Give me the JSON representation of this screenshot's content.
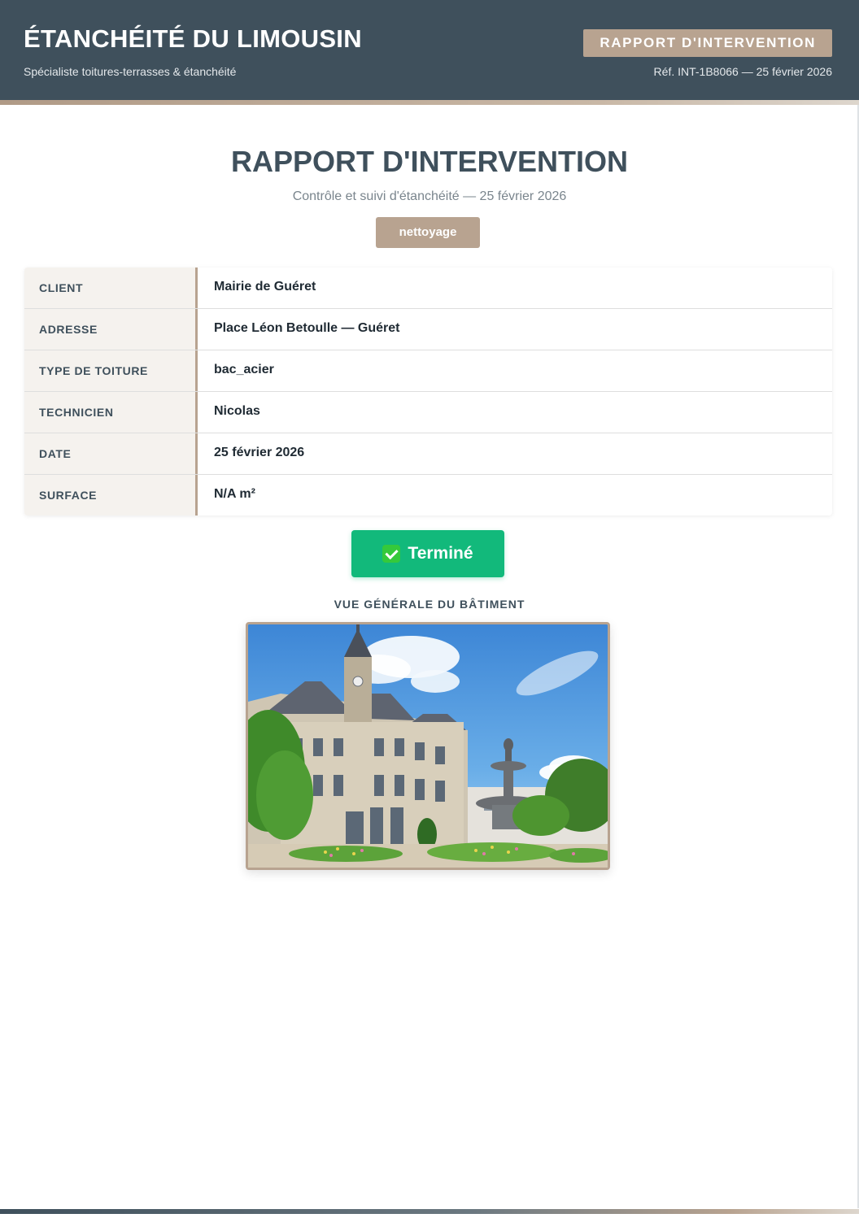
{
  "header": {
    "company_name": "ÉTANCHÉITÉ DU LIMOUSIN",
    "tagline": "Spécialiste toitures-terrasses & étanchéité",
    "badge": "RAPPORT D'INTERVENTION",
    "reference": "Réf. INT-1B8066 — 25 février 2026"
  },
  "report": {
    "title": "RAPPORT D'INTERVENTION",
    "subtitle": "Contrôle et suivi d'étanchéité — 25 février 2026",
    "type_tag": "nettoyage"
  },
  "info": [
    {
      "label": "CLIENT",
      "value": "Mairie de Guéret"
    },
    {
      "label": "ADRESSE",
      "value": "Place Léon Betoulle — Guéret"
    },
    {
      "label": "TYPE DE TOITURE",
      "value": "bac_acier"
    },
    {
      "label": "TECHNICIEN",
      "value": "Nicolas"
    },
    {
      "label": "DATE",
      "value": "25 février 2026"
    },
    {
      "label": "SURFACE",
      "value": "N/A m²"
    }
  ],
  "status": {
    "label": "Terminé",
    "icon": "check-mark-icon",
    "color": "#12b97b"
  },
  "photo": {
    "caption": "VUE GÉNÉRALE DU BÂTIMENT"
  },
  "colors": {
    "header_bg": "#3f505c",
    "accent": "#b8a390",
    "success": "#12b97b"
  }
}
